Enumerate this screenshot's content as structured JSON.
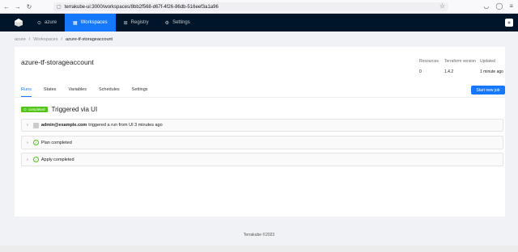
{
  "browser": {
    "url": "terrakube-ui:3000/workspaces/8bb2f568-d67f-4f26-86db-516eef3a1a96"
  },
  "header": {
    "org": "azure",
    "menu": [
      {
        "label": "Workspaces"
      },
      {
        "label": "Registry"
      },
      {
        "label": "Settings"
      }
    ]
  },
  "breadcrumb": [
    "azure",
    "Workspaces",
    "azure-tf-storageaccount"
  ],
  "workspace": {
    "name": "azure-tf-storageaccount",
    "meta": [
      {
        "label": "Resources",
        "value": "0"
      },
      {
        "label": "Terraform version",
        "value": "1.4.2"
      },
      {
        "label": "Updated",
        "value": "1 minute ago"
      }
    ]
  },
  "tabs": [
    "Runs",
    "States",
    "Variables",
    "Schedules",
    "Settings"
  ],
  "start_button": "Start new job",
  "run": {
    "badge": "completed",
    "title": "Triggered via UI",
    "trigger_user": "admin@example.com",
    "trigger_text": "triggered a run from UI 3 minutes ago",
    "steps": [
      "Plan completed",
      "Apply completed"
    ]
  },
  "footer": "Terrakube ©2023",
  "colors": {
    "accent": "#1677ff",
    "header_bg": "#001529",
    "success": "#52c41a"
  }
}
